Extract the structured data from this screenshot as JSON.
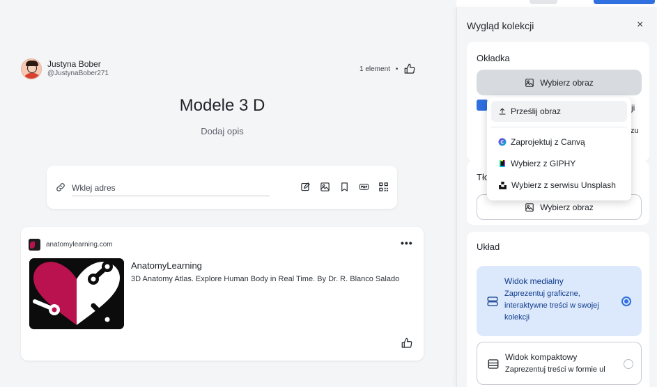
{
  "author": {
    "name": "Justyna Bober",
    "handle": "@JustynaBober271"
  },
  "collection": {
    "count_label": "1 element",
    "dot": "•",
    "title": "Modele 3 D",
    "description_placeholder": "Dodaj opis"
  },
  "url_bar": {
    "placeholder": "Wklej adres"
  },
  "item": {
    "domain": "anatomylearning.com",
    "more": "•••",
    "title": "AnatomyLearning",
    "description": "3D Anatomy Atlas. Explore Human Body in Real Time. By Dr. R. Blanco Salado",
    "brand_color": "#b9124e"
  },
  "panel": {
    "title": "Wygląd kolekcji",
    "close": "×",
    "cover": {
      "label": "Okładka",
      "choose_button": "Wybierz obraz",
      "peek_text_1": "ji",
      "peek_text_2": "zu",
      "checkbox_checked": true
    },
    "background": {
      "label": "Tło",
      "choose_button": "Wybierz obraz"
    },
    "layout": {
      "label": "Układ",
      "options": [
        {
          "title": "Widok medialny",
          "description": "Zaprezentuj graficzne, interaktywne treści w swojej kolekcji",
          "selected": true
        },
        {
          "title": "Widok kompaktowy",
          "description": "Zaprezentuj treści w formie ul",
          "selected": false
        }
      ]
    }
  },
  "dropdown": {
    "items": [
      {
        "label": "Prześlij obraz",
        "icon": "upload-icon"
      },
      {
        "label": "Zaprojektuj z Canvą",
        "icon": "canva-icon"
      },
      {
        "label": "Wybierz z GIPHY",
        "icon": "giphy-icon"
      },
      {
        "label": "Wybierz z serwisu Unsplash",
        "icon": "unsplash-icon"
      }
    ]
  },
  "colors": {
    "accent": "#2f6fe0",
    "selected_bg": "#dce8fc"
  }
}
